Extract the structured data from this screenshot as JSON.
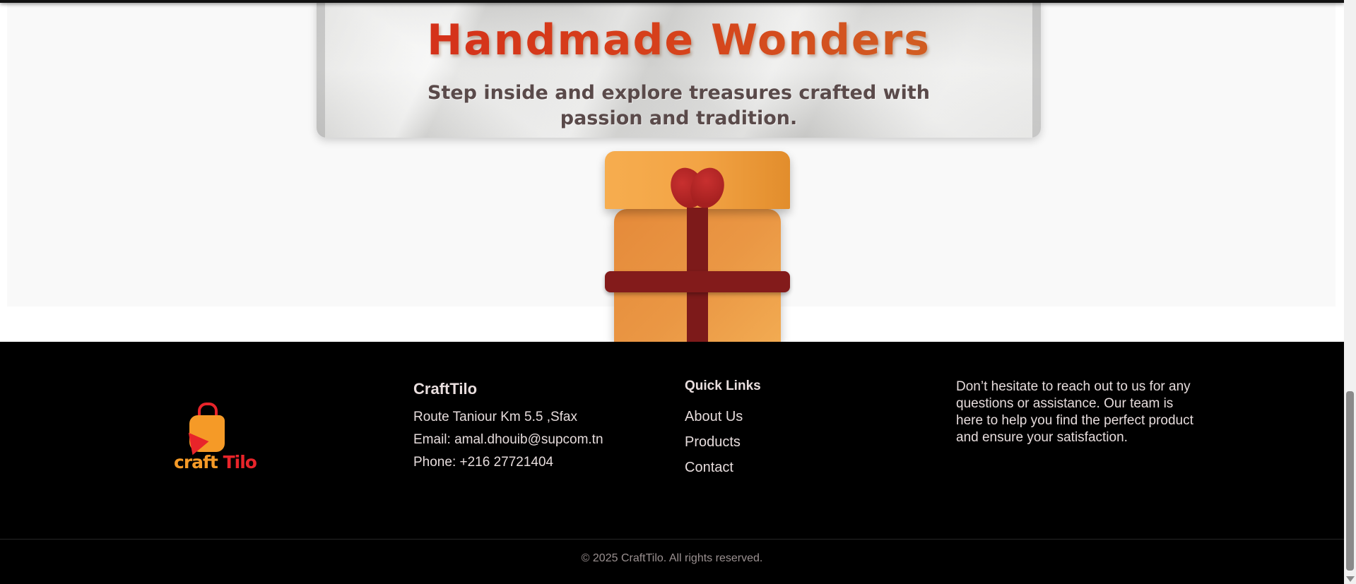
{
  "hero": {
    "title": "Handmade Wonders",
    "subtitle": "Step inside and explore treasures crafted with passion and tradition."
  },
  "footer": {
    "logo": {
      "word1": "craft",
      "word2": "Tilo"
    },
    "brand": {
      "title": "CraftTilo",
      "address": "Route Taniour Km 5.5 ,Sfax",
      "email": "Email: amal.dhouib@supcom.tn",
      "phone": "Phone: +216 27721404"
    },
    "quick_links": {
      "title": "Quick Links",
      "items": [
        "About Us",
        "Products",
        "Contact"
      ]
    },
    "about": {
      "text": "Don’t hesitate to reach out to us for any questions or assistance. Our team is here to help you find the perfect product and ensure your satisfaction."
    },
    "copyright": "© 2025 CraftTilo. All rights reserved."
  },
  "colors": {
    "footer_bg": "#000000",
    "accent_orange": "#f59a27",
    "accent_red": "#e8242a",
    "ribbon": "#7d1a1a",
    "title_red": "#d42a1a"
  },
  "icons": [
    "gift-box-icon",
    "shopping-bag-logo-icon",
    "cursor-arrow-icon",
    "scroll-down-arrow-icon"
  ]
}
